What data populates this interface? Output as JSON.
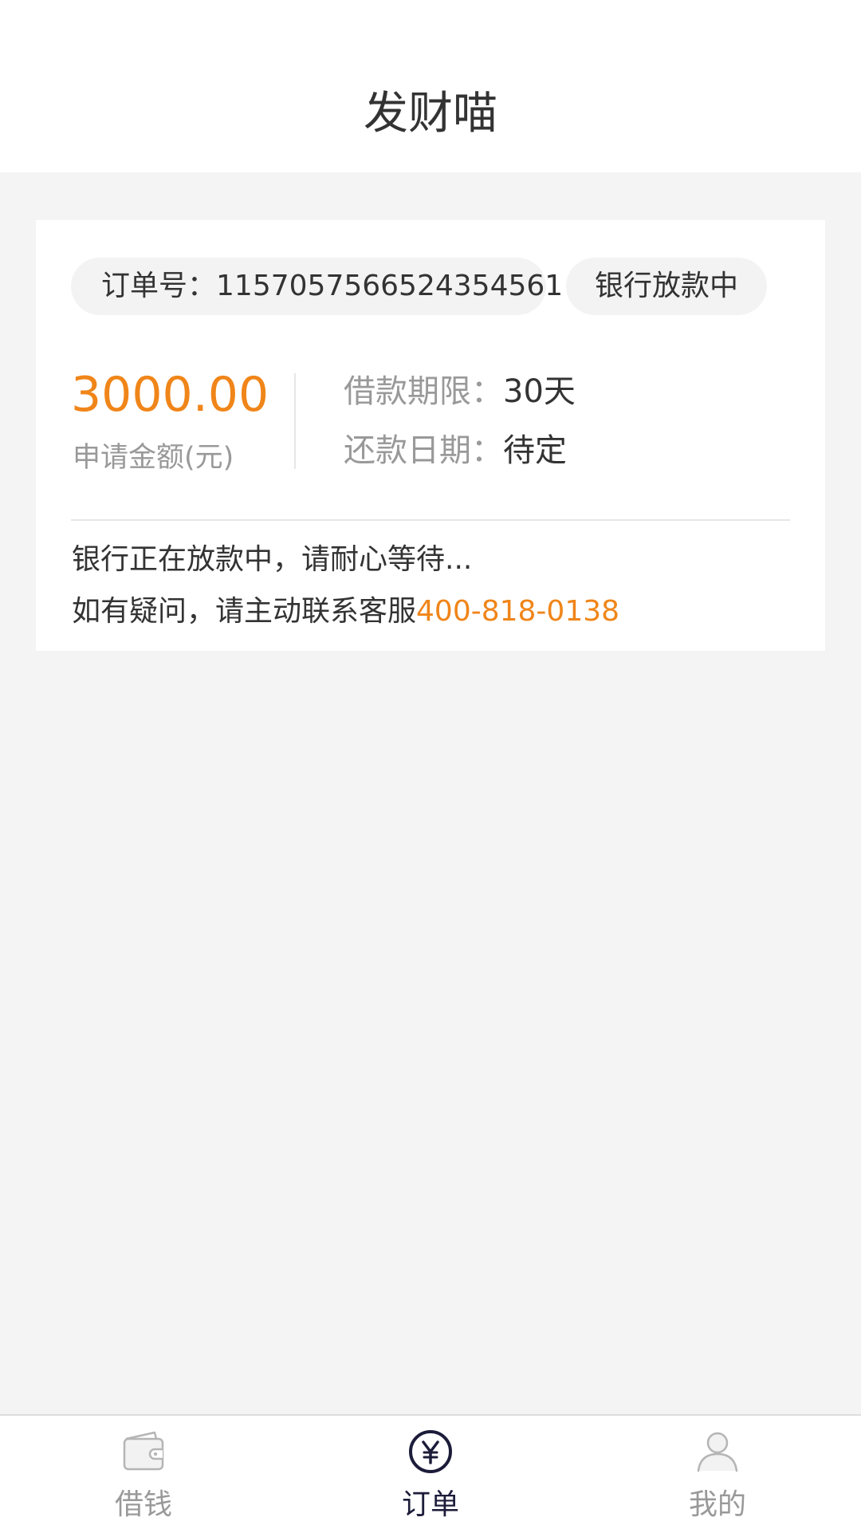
{
  "header": {
    "title": "发财喵"
  },
  "order": {
    "number_label": "订单号：",
    "number": "1157057566524354561",
    "status": "银行放款中",
    "amount": "3000.00",
    "amount_label": "申请金额(元)",
    "term_label": "借款期限：",
    "term_value": "30天",
    "due_label": "还款日期：",
    "due_value": "待定",
    "note_line1": "银行正在放款中，请耐心等待...",
    "note_line2_prefix": "如有疑问，请主动联系客服",
    "service_phone": "400-818-0138"
  },
  "tabs": [
    {
      "label": "借钱",
      "icon": "wallet-icon",
      "active": false
    },
    {
      "label": "订单",
      "icon": "yuan-circle-icon",
      "active": true
    },
    {
      "label": "我的",
      "icon": "user-icon",
      "active": false
    }
  ],
  "colors": {
    "accent": "#f08519",
    "active_tab": "#1c1c3a",
    "inactive_tab": "#999999",
    "background": "#f4f4f4"
  }
}
